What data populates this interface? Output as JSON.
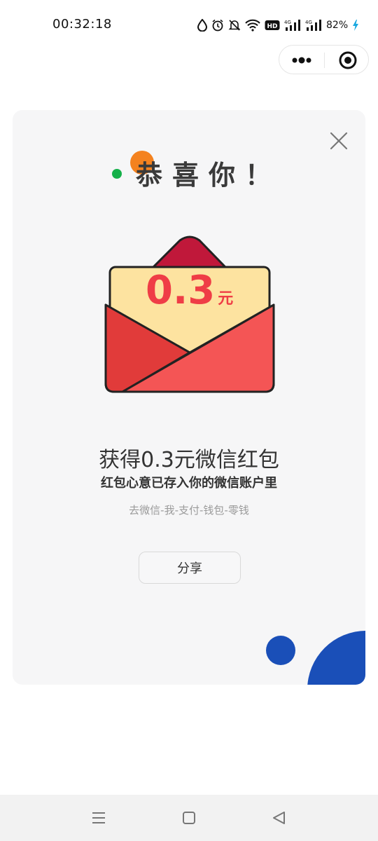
{
  "status_bar": {
    "time": "00:32:18",
    "network_label": "4G",
    "hd_label": "HD",
    "battery": "82%",
    "icons": [
      "drop-icon",
      "alarm-icon",
      "mute-icon",
      "wifi-icon",
      "hd-icon",
      "signal-icon",
      "signal-icon",
      "charging-icon"
    ]
  },
  "capsule": {
    "more_icon": "more-dots-icon",
    "close_icon": "target-circle-icon"
  },
  "card": {
    "congrats": "恭喜你！",
    "amount": "0.3",
    "amount_unit": "元",
    "headline": "获得0.3元微信红包",
    "subline": "红包心意已存入你的微信账户里",
    "hint": "去微信-我-支付-钱包-零钱",
    "share_label": "分享",
    "close_icon": "close-icon",
    "colors": {
      "envelope_red": "#ef5350",
      "envelope_flap": "#c0183a",
      "letter": "#fde3a0",
      "accent_blue": "#1a4fb8",
      "accent_green": "#15b04a",
      "accent_orange": "#f4821f"
    }
  },
  "nav": {
    "menu_icon": "menu-icon",
    "home_icon": "home-square-icon",
    "back_icon": "back-triangle-icon"
  }
}
